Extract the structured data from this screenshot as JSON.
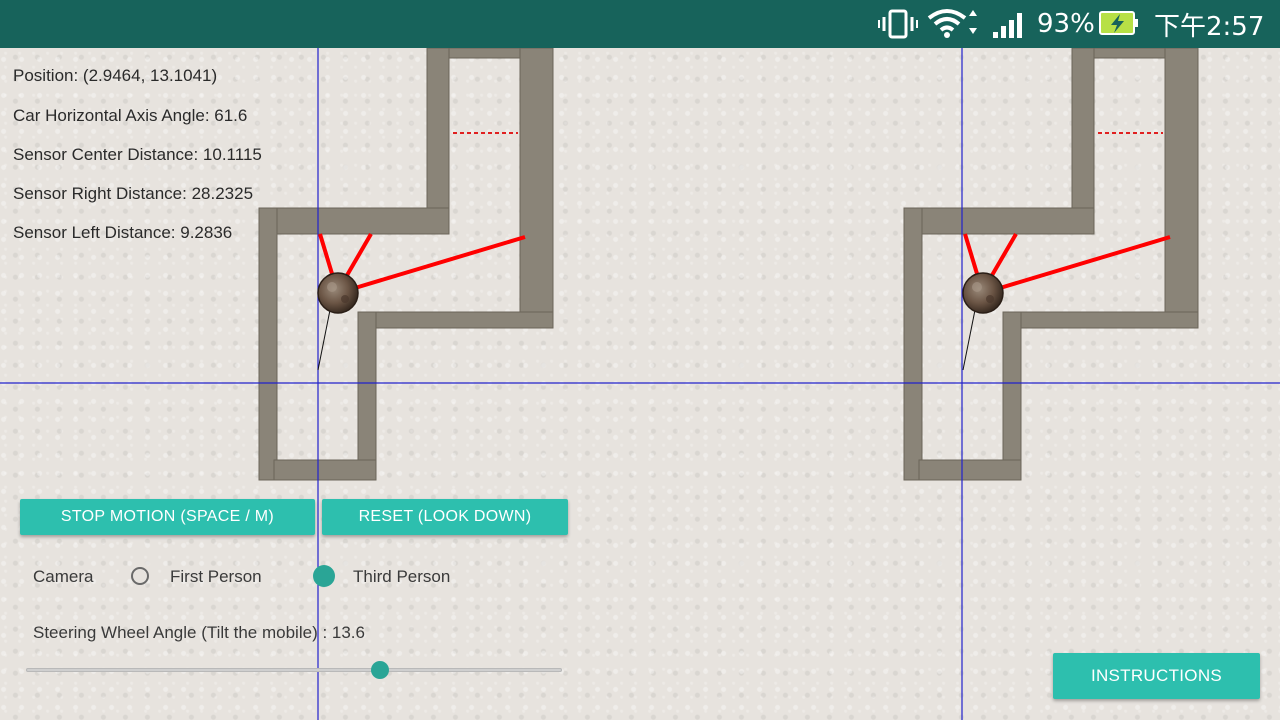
{
  "status_bar": {
    "battery_percent": "93%",
    "time": "下午2:57",
    "icons": [
      "vibrate-icon",
      "wifi-icon",
      "signal-icon",
      "battery-charging-icon"
    ]
  },
  "telemetry": {
    "position": "Position: (2.9464, 13.1041)",
    "car_angle": "Car Horizontal Axis Angle: 61.6",
    "sensor_center": "Sensor Center Distance: 10.1115",
    "sensor_right": "Sensor Right Distance: 28.2325",
    "sensor_left": "Sensor Left Distance: 9.2836"
  },
  "buttons": {
    "stop_motion": "STOP MOTION (SPACE / M)",
    "reset": "RESET (LOOK DOWN)",
    "instructions": "INSTRUCTIONS"
  },
  "camera": {
    "label": "Camera",
    "options": [
      "First Person",
      "Third Person"
    ],
    "selected": "Third Person"
  },
  "steering": {
    "label": "Steering Wheel Angle (Tilt the mobile) : 13.6",
    "slider_fraction": 0.66
  },
  "colors": {
    "accent": "#2dbfae",
    "status_bar": "#17635b",
    "sensor_rays": "#ff0000",
    "axis_lines": "#2222cc",
    "track_wall": "#8a8478"
  }
}
